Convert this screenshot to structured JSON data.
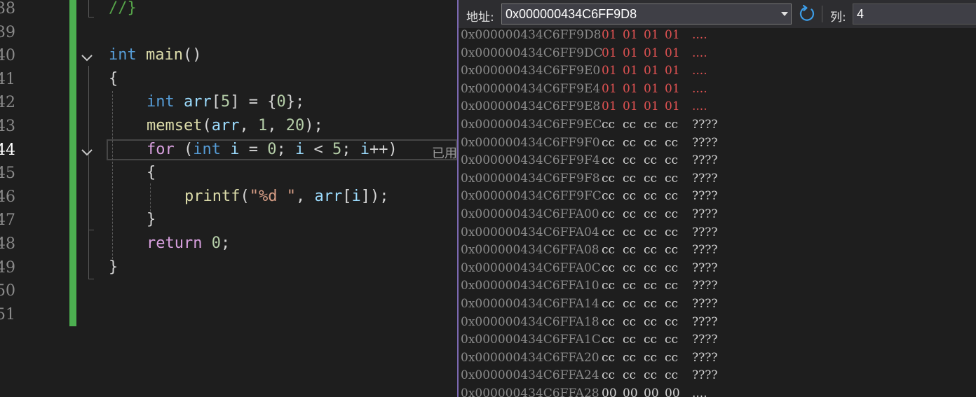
{
  "editor": {
    "lines": [
      {
        "num": "38",
        "current": false,
        "fold": "none",
        "indent": 155,
        "tokens": [
          {
            "t": "//}",
            "c": "cmt"
          }
        ]
      },
      {
        "num": "39",
        "current": false,
        "fold": "none",
        "indent": 155,
        "tokens": []
      },
      {
        "num": "40",
        "current": false,
        "fold": "open",
        "indent": 155,
        "tokens": [
          {
            "t": "int",
            "c": "kw"
          },
          {
            "t": " ",
            "c": ""
          },
          {
            "t": "main",
            "c": "fn"
          },
          {
            "t": "()",
            "c": ""
          }
        ]
      },
      {
        "num": "41",
        "current": false,
        "fold": "none",
        "indent": 155,
        "tokens": [
          {
            "t": "{",
            "c": ""
          }
        ]
      },
      {
        "num": "42",
        "current": false,
        "fold": "none",
        "indent": 209,
        "tokens": [
          {
            "t": "int",
            "c": "kw"
          },
          {
            "t": " ",
            "c": ""
          },
          {
            "t": "arr",
            "c": "var"
          },
          {
            "t": "[",
            "c": ""
          },
          {
            "t": "5",
            "c": "num"
          },
          {
            "t": "] = {",
            "c": ""
          },
          {
            "t": "0",
            "c": "num"
          },
          {
            "t": "};",
            "c": ""
          }
        ]
      },
      {
        "num": "43",
        "current": false,
        "fold": "none",
        "indent": 209,
        "tokens": [
          {
            "t": "memset",
            "c": "fn"
          },
          {
            "t": "(",
            "c": ""
          },
          {
            "t": "arr",
            "c": "var"
          },
          {
            "t": ", ",
            "c": ""
          },
          {
            "t": "1",
            "c": "num"
          },
          {
            "t": ", ",
            "c": ""
          },
          {
            "t": "20",
            "c": "num"
          },
          {
            "t": ");",
            "c": ""
          }
        ]
      },
      {
        "num": "44",
        "current": true,
        "fold": "open",
        "indent": 209,
        "tokens": [
          {
            "t": "for",
            "c": "ctl"
          },
          {
            "t": " (",
            "c": ""
          },
          {
            "t": "int",
            "c": "kw"
          },
          {
            "t": " ",
            "c": ""
          },
          {
            "t": "i",
            "c": "var"
          },
          {
            "t": " = ",
            "c": ""
          },
          {
            "t": "0",
            "c": "num"
          },
          {
            "t": "; ",
            "c": ""
          },
          {
            "t": "i",
            "c": "var"
          },
          {
            "t": " < ",
            "c": ""
          },
          {
            "t": "5",
            "c": "num"
          },
          {
            "t": "; ",
            "c": ""
          },
          {
            "t": "i",
            "c": "var"
          },
          {
            "t": "++)",
            "c": ""
          }
        ]
      },
      {
        "num": "45",
        "current": false,
        "fold": "none",
        "indent": 209,
        "tokens": [
          {
            "t": "{",
            "c": ""
          }
        ]
      },
      {
        "num": "46",
        "current": false,
        "fold": "none",
        "indent": 263,
        "tokens": [
          {
            "t": "printf",
            "c": "fn"
          },
          {
            "t": "(",
            "c": ""
          },
          {
            "t": "\"%d \"",
            "c": "str"
          },
          {
            "t": ", ",
            "c": ""
          },
          {
            "t": "arr",
            "c": "var"
          },
          {
            "t": "[",
            "c": ""
          },
          {
            "t": "i",
            "c": "var"
          },
          {
            "t": "]);",
            "c": ""
          }
        ]
      },
      {
        "num": "47",
        "current": false,
        "fold": "none",
        "indent": 209,
        "tokens": [
          {
            "t": "}",
            "c": ""
          }
        ]
      },
      {
        "num": "48",
        "current": false,
        "fold": "none",
        "indent": 209,
        "tokens": [
          {
            "t": "return",
            "c": "ctl"
          },
          {
            "t": " ",
            "c": ""
          },
          {
            "t": "0",
            "c": "num"
          },
          {
            "t": ";",
            "c": ""
          }
        ]
      },
      {
        "num": "49",
        "current": false,
        "fold": "none",
        "indent": 155,
        "tokens": [
          {
            "t": "}",
            "c": ""
          }
        ]
      },
      {
        "num": "50",
        "current": false,
        "fold": "none",
        "indent": 155,
        "tokens": []
      },
      {
        "num": "51",
        "current": false,
        "fold": "none",
        "indent": 155,
        "tokens": []
      }
    ],
    "elapsed_hint": "已用"
  },
  "memory": {
    "address_label": "地址:",
    "address_value": "0x000000434C6FF9D8",
    "columns_label": "列:",
    "columns_value": "4",
    "changed_color": "#e05252",
    "rows": [
      {
        "addr": "0x000000434C6FF9D8",
        "bytes": [
          "01",
          "01",
          "01",
          "01"
        ],
        "ascii": "....",
        "changed": true
      },
      {
        "addr": "0x000000434C6FF9DC",
        "bytes": [
          "01",
          "01",
          "01",
          "01"
        ],
        "ascii": "....",
        "changed": true
      },
      {
        "addr": "0x000000434C6FF9E0",
        "bytes": [
          "01",
          "01",
          "01",
          "01"
        ],
        "ascii": "....",
        "changed": true
      },
      {
        "addr": "0x000000434C6FF9E4",
        "bytes": [
          "01",
          "01",
          "01",
          "01"
        ],
        "ascii": "....",
        "changed": true
      },
      {
        "addr": "0x000000434C6FF9E8",
        "bytes": [
          "01",
          "01",
          "01",
          "01"
        ],
        "ascii": "....",
        "changed": true
      },
      {
        "addr": "0x000000434C6FF9EC",
        "bytes": [
          "cc",
          "cc",
          "cc",
          "cc"
        ],
        "ascii": "????",
        "changed": false
      },
      {
        "addr": "0x000000434C6FF9F0",
        "bytes": [
          "cc",
          "cc",
          "cc",
          "cc"
        ],
        "ascii": "????",
        "changed": false
      },
      {
        "addr": "0x000000434C6FF9F4",
        "bytes": [
          "cc",
          "cc",
          "cc",
          "cc"
        ],
        "ascii": "????",
        "changed": false
      },
      {
        "addr": "0x000000434C6FF9F8",
        "bytes": [
          "cc",
          "cc",
          "cc",
          "cc"
        ],
        "ascii": "????",
        "changed": false
      },
      {
        "addr": "0x000000434C6FF9FC",
        "bytes": [
          "cc",
          "cc",
          "cc",
          "cc"
        ],
        "ascii": "????",
        "changed": false
      },
      {
        "addr": "0x000000434C6FFA00",
        "bytes": [
          "cc",
          "cc",
          "cc",
          "cc"
        ],
        "ascii": "????",
        "changed": false
      },
      {
        "addr": "0x000000434C6FFA04",
        "bytes": [
          "cc",
          "cc",
          "cc",
          "cc"
        ],
        "ascii": "????",
        "changed": false
      },
      {
        "addr": "0x000000434C6FFA08",
        "bytes": [
          "cc",
          "cc",
          "cc",
          "cc"
        ],
        "ascii": "????",
        "changed": false
      },
      {
        "addr": "0x000000434C6FFA0C",
        "bytes": [
          "cc",
          "cc",
          "cc",
          "cc"
        ],
        "ascii": "????",
        "changed": false
      },
      {
        "addr": "0x000000434C6FFA10",
        "bytes": [
          "cc",
          "cc",
          "cc",
          "cc"
        ],
        "ascii": "????",
        "changed": false
      },
      {
        "addr": "0x000000434C6FFA14",
        "bytes": [
          "cc",
          "cc",
          "cc",
          "cc"
        ],
        "ascii": "????",
        "changed": false
      },
      {
        "addr": "0x000000434C6FFA18",
        "bytes": [
          "cc",
          "cc",
          "cc",
          "cc"
        ],
        "ascii": "????",
        "changed": false
      },
      {
        "addr": "0x000000434C6FFA1C",
        "bytes": [
          "cc",
          "cc",
          "cc",
          "cc"
        ],
        "ascii": "????",
        "changed": false
      },
      {
        "addr": "0x000000434C6FFA20",
        "bytes": [
          "cc",
          "cc",
          "cc",
          "cc"
        ],
        "ascii": "????",
        "changed": false
      },
      {
        "addr": "0x000000434C6FFA24",
        "bytes": [
          "cc",
          "cc",
          "cc",
          "cc"
        ],
        "ascii": "????",
        "changed": false
      },
      {
        "addr": "0x000000434C6FFA28",
        "bytes": [
          "00",
          "00",
          "00",
          "00"
        ],
        "ascii": "....",
        "changed": false
      }
    ]
  },
  "icons": {
    "fold": "chevron-down-icon",
    "refresh": "refresh-icon",
    "dropdown": "dropdown-arrow-icon"
  }
}
